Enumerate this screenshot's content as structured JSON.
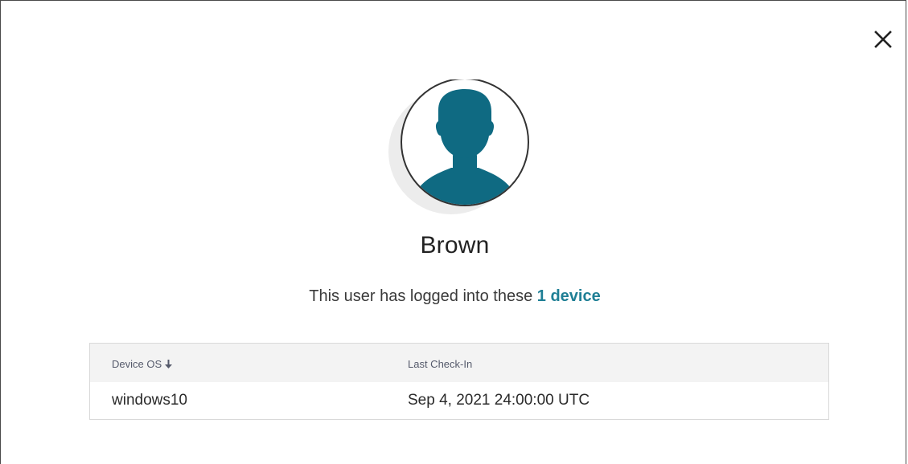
{
  "dialog": {
    "close_label": "×"
  },
  "user": {
    "name": "Brown",
    "avatar_icon": "user-silhouette-icon"
  },
  "summary": {
    "prefix": "This user has logged into these",
    "device_link": "1 device"
  },
  "table": {
    "columns": [
      "Device OS",
      "Last Check-In"
    ],
    "sort": {
      "column": "Device OS",
      "direction": "descending",
      "icon": "arrow-down-icon"
    },
    "rows": [
      {
        "os": "windows10",
        "last_check_in": "Sep 4, 2021 24:00:00 UTC"
      }
    ]
  },
  "colors": {
    "accent": "#1f7f95",
    "avatar": "#0f6a82",
    "header_bg": "#f3f3f3"
  }
}
